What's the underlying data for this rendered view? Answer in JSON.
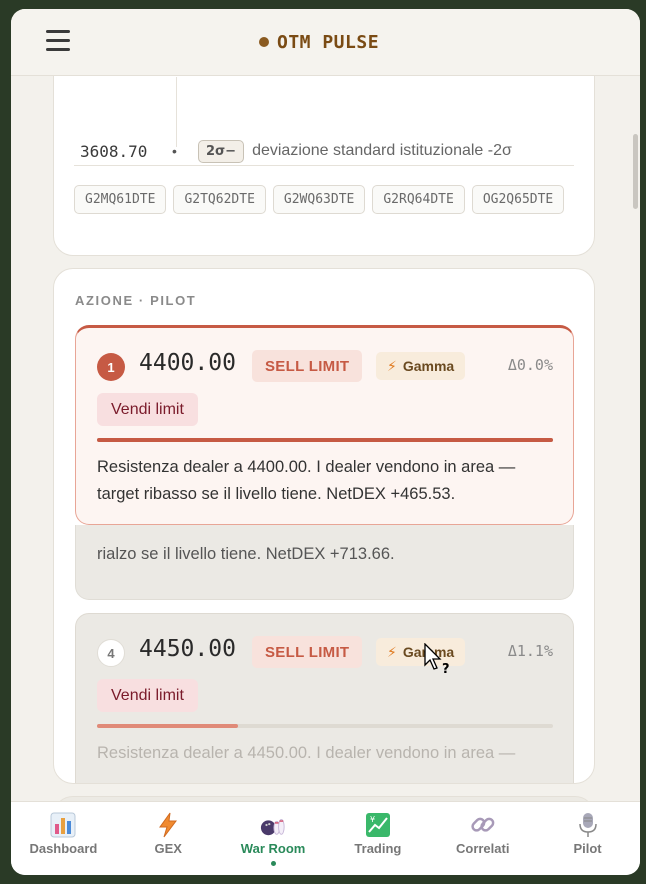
{
  "header": {
    "title": "OTM PULSE",
    "menu_icon": "hamburger-icon"
  },
  "levels_card": {
    "levels": [
      {
        "price": "3608.70",
        "bullet": "•",
        "badge": "2σ−",
        "desc": "deviazione standard istituzionale -2σ"
      }
    ],
    "chips": [
      "G2MQ61DTE",
      "G2TQ62DTE",
      "G2WQ63DTE",
      "G2RQ64DTE",
      "OG2Q65DTE"
    ]
  },
  "pilot_card": {
    "section_label": "AZIONE · PILOT",
    "signals": [
      {
        "index": "1",
        "price": "4400.00",
        "order_type": "SELL LIMIT",
        "tag": "Gamma",
        "delta": "Δ0.0%",
        "action": "Vendi limit",
        "progress": 1.0,
        "text": "Resistenza dealer a 4400.00. I dealer vendono in area — target ribasso se il livello tiene. NetDEX +465.53."
      },
      {
        "index": "4",
        "price": "4450.00",
        "order_type": "SELL LIMIT",
        "tag": "Gamma",
        "delta": "Δ1.1%",
        "action": "Vendi limit",
        "progress": 0.31,
        "text": "Resistenza dealer a 4450.00. I dealer vendono in area —"
      }
    ],
    "behind_text_visible": "rialzo se il livello tiene. NetDEX +713.66."
  },
  "bottom_nav": {
    "items": [
      {
        "label": "Dashboard",
        "icon": "bar-chart-icon"
      },
      {
        "label": "GEX",
        "icon": "lightning-icon"
      },
      {
        "label": "War Room",
        "icon": "bowling-icon",
        "active": true
      },
      {
        "label": "Trading",
        "icon": "chart-increasing-icon"
      },
      {
        "label": "Correlati",
        "icon": "link-icon"
      },
      {
        "label": "Pilot",
        "icon": "microphone-icon"
      }
    ]
  },
  "colors": {
    "accent_red": "#c65a44",
    "active_nav": "#2a8a5a",
    "brand": "#7a4b14"
  }
}
